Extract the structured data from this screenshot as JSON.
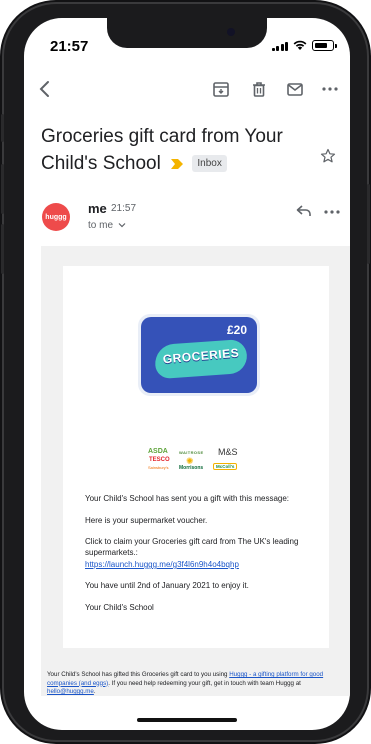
{
  "status_bar": {
    "time": "21:57"
  },
  "toolbar": {
    "back_icon": "back-arrow-icon",
    "archive_icon": "archive-icon",
    "delete_icon": "trash-icon",
    "mark_unread_icon": "mail-icon",
    "more_icon": "more-horizontal-icon"
  },
  "email": {
    "subject": "Groceries gift card from Your Child's School",
    "label": "Inbox",
    "sender_name": "me",
    "sender_time": "21:57",
    "recipient": "to me",
    "avatar_text": "huggg"
  },
  "body": {
    "gift_amount": "£20",
    "gift_word": "GROCERIES",
    "logos": [
      "ASDA",
      "WAITROSE",
      "M&S",
      "TESCO",
      "Sainsbury's",
      "Morrisons",
      "McColl's"
    ],
    "line1": "Your Child's School has sent you a gift with this message:",
    "line2": "Here is your supermarket voucher.",
    "line3": "Click to claim your Groceries gift card from The UK's leading supermarkets.:",
    "link": "https://launch.huggg.me/g3f4l6n9h4o4bqhp",
    "line4": "You have until 2nd of January 2021 to enjoy it.",
    "signature": "Your Child's School"
  },
  "footer": {
    "text_a": "Your Child's School has gifted this Groceries gift card to you using ",
    "link_a": "Huggg - a gifting platform for good companies (and eggs)",
    "text_b": ". If you need help redeeming your gift, get in touch with team Huggg at ",
    "link_b": "hello@huggg.me",
    "text_c": "."
  },
  "colors": {
    "avatar": "#ee4b4b",
    "important_marker": "#f4b400",
    "link": "#1a55c8",
    "gift_card": "#3552b8",
    "gift_blob": "#47c9c0"
  }
}
